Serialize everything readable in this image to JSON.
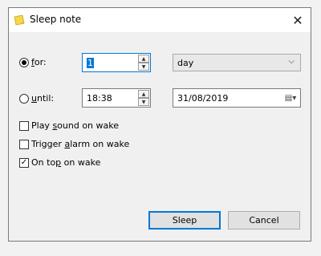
{
  "window": {
    "title": "Sleep note",
    "icon": "sticky-note-icon",
    "close_glyph": "✕"
  },
  "for_option": {
    "label_pre": "",
    "label_access": "f",
    "label_post": "or:",
    "selected": true,
    "value": "1",
    "unit_selected": "day"
  },
  "until_option": {
    "label_pre": "",
    "label_access": "u",
    "label_post": "ntil:",
    "selected": false,
    "time": "18:38",
    "date": "31/08/2019"
  },
  "options": [
    {
      "pre": "Play ",
      "access": "s",
      "post": "ound on wake",
      "checked": false
    },
    {
      "pre": "Trigger ",
      "access": "a",
      "post": "larm on wake",
      "checked": false
    },
    {
      "pre": "On to",
      "access": "p",
      "post": " on wake",
      "checked": true
    }
  ],
  "buttons": {
    "sleep": "Sleep",
    "cancel": "Cancel"
  },
  "colors": {
    "accent": "#0078d7",
    "note_icon": "#f7d64a"
  }
}
